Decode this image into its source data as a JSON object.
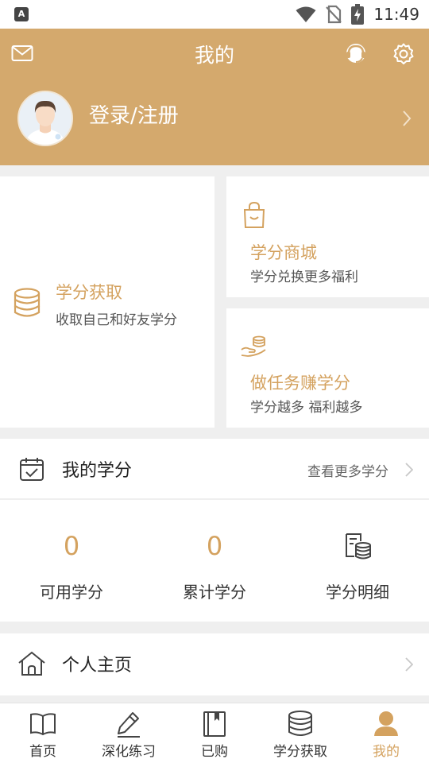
{
  "status_bar": {
    "app_indicator": "A",
    "time": "11:49",
    "icons": [
      "wifi-icon",
      "no-sim-icon",
      "battery-charging-icon"
    ]
  },
  "header": {
    "title": "我的",
    "login_text": "登录/注册",
    "left_icon": "mail-icon",
    "right_icons": [
      "customer-service-icon",
      "gear-icon"
    ],
    "color": "#d4a96d"
  },
  "cards": {
    "earn": {
      "title": "学分获取",
      "subtitle": "收取自己和好友学分",
      "icon": "coin-stack-icon"
    },
    "shop": {
      "title": "学分商城",
      "subtitle": "学分兑换更多福利",
      "icon": "shopping-bag-icon"
    },
    "task": {
      "title": "做任务赚学分",
      "subtitle": "学分越多 福利越多",
      "icon": "hand-coins-icon"
    }
  },
  "my_credits": {
    "title": "我的学分",
    "more_label": "查看更多学分",
    "stats": [
      {
        "value": "0",
        "label": "可用学分"
      },
      {
        "value": "0",
        "label": "累计学分"
      },
      {
        "label": "学分明细",
        "icon": "credit-detail-icon"
      }
    ]
  },
  "homepage": {
    "title": "个人主页"
  },
  "bottom_nav": {
    "items": [
      {
        "label": "首页",
        "icon": "book-open-icon"
      },
      {
        "label": "深化练习",
        "icon": "pencil-icon"
      },
      {
        "label": "已购",
        "icon": "bookmark-book-icon"
      },
      {
        "label": "学分获取",
        "icon": "coin-stack-icon"
      },
      {
        "label": "我的",
        "icon": "user-icon"
      }
    ],
    "active_index": 4,
    "active_color": "#d4a25f"
  }
}
